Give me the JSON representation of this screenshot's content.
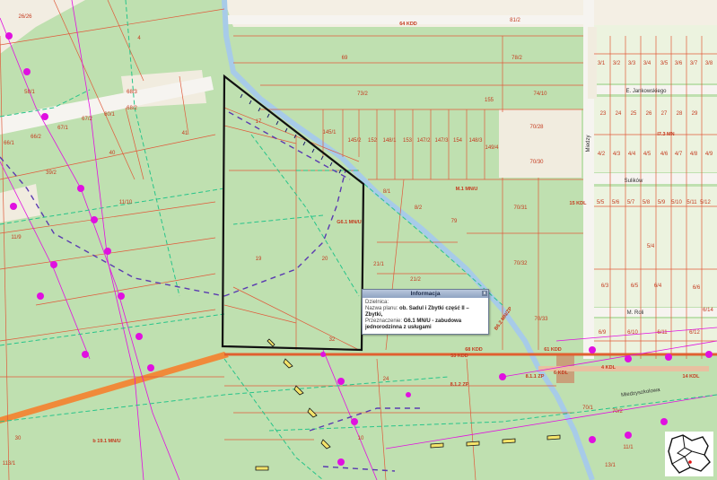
{
  "map": {
    "parcel_labels": [
      "26/26",
      "4",
      "69",
      "78/2",
      "81/2",
      "73/2",
      "74/10",
      "155",
      "70/28",
      "70/30",
      "70/31",
      "70/32",
      "70/33",
      "79",
      "8/2",
      "8/1",
      "21/1",
      "21/2",
      "19",
      "17",
      "20",
      "68/3",
      "68/2",
      "66/2",
      "67/2",
      "39/2",
      "41",
      "40",
      "11/10",
      "11/9",
      "60/1",
      "66/1",
      "67/1",
      "58/1",
      "145/1",
      "145/2",
      "152",
      "148/1",
      "153",
      "147/2",
      "147/3",
      "154",
      "148/3",
      "149/4",
      "3/1",
      "3/2",
      "3/3",
      "3/4",
      "3/5",
      "3/6",
      "3/7",
      "3/8",
      "23",
      "24",
      "25",
      "26",
      "27",
      "28",
      "29",
      "4/2",
      "4/3",
      "4/4",
      "4/5",
      "4/6",
      "4/7",
      "4/8",
      "4/9",
      "5/5",
      "5/6",
      "5/7",
      "5/8",
      "5/9",
      "5/10",
      "5/11",
      "5/12",
      "5/4",
      "6/3",
      "6/4",
      "6/5",
      "6/6",
      "6/9",
      "6/10",
      "6/11",
      "6/12",
      "70/1",
      "70/2",
      "6/14",
      "30",
      "24",
      "32",
      "10",
      "13/1",
      "11/1",
      "113/1",
      "5"
    ],
    "zone_labels": [
      "G6.1 MN/U",
      "M.1 MN/U",
      "I7.3 MN",
      "64 KDD",
      "15 KDL",
      "B6.2 MN/ZP",
      "68 KDD",
      "53 KDD",
      "61 KDD",
      "8.1.2 ZP",
      "8.1.1 ZP",
      "6 KDL",
      "4 KDL",
      "14 KDL",
      "b 19.1 MN/U"
    ],
    "street_labels": [
      "E. Jankowskiego",
      "Sulików",
      "M. Roli",
      "Miedzyszkolowa",
      "Miedzy"
    ]
  },
  "popup": {
    "title": "Informacja",
    "close_label": "x",
    "district_label": "Dzielnica:",
    "plan_label": "Nazwa planu:",
    "plan_name": "ob. Sadul i Zbytki część II – Zbytki,",
    "purpose_label": "Przeznaczenie:",
    "purpose_value": "G6.1 MN/U - zabudowa jednorodzinna z usługami"
  },
  "colors": {
    "background": "#bfe0b0",
    "parcel_line": "#e05a3a",
    "highlight": "#111111",
    "road": "#f6f4f0",
    "green_dash": "#28c48a",
    "magenta": "#e010e0",
    "purple_dash": "#5a3ab0",
    "river": "#a7cbe8"
  }
}
